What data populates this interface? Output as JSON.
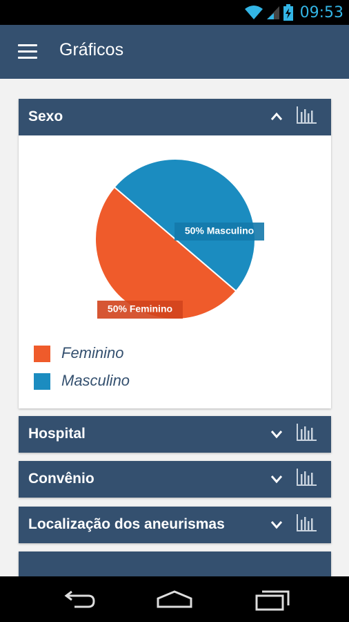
{
  "status_bar": {
    "time": "09:53",
    "time_color": "#33b5e5"
  },
  "app_bar": {
    "title": "Gráficos",
    "menu_icon": "menu-icon",
    "background": "#34506f"
  },
  "panels": [
    {
      "title": "Sexo",
      "expanded": true,
      "chevron": "chevron-up-icon",
      "action_icon": "bar-chart-icon"
    },
    {
      "title": "Hospital",
      "expanded": false,
      "chevron": "chevron-down-icon",
      "action_icon": "bar-chart-icon"
    },
    {
      "title": "Convênio",
      "expanded": false,
      "chevron": "chevron-down-icon",
      "action_icon": "bar-chart-icon"
    },
    {
      "title": "Localização dos aneurismas",
      "expanded": false,
      "chevron": "chevron-down-icon",
      "action_icon": "bar-chart-icon"
    }
  ],
  "chart_data": {
    "type": "pie",
    "categories": [
      "Feminino",
      "Masculino"
    ],
    "values": [
      50,
      50
    ],
    "slice_labels": [
      "50%  Feminino",
      "50%  Masculino"
    ],
    "colors": [
      "#ef5b2b",
      "#1b8cc0"
    ],
    "legend": [
      "Feminino",
      "Masculino"
    ],
    "legend_position": "bottom-left"
  },
  "nav_bar": {
    "back": "back-icon",
    "home": "home-icon",
    "recents": "recents-icon"
  }
}
